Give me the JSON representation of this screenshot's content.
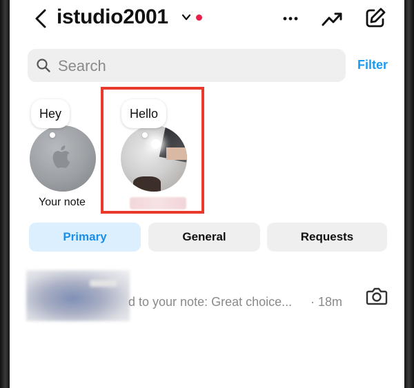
{
  "header": {
    "account_name": "istudio2001",
    "back_icon": "chevron-left-icon",
    "account_switch_icon": "chevron-down-icon",
    "unread_indicator_color": "#e8204a",
    "actions": [
      "more-icon",
      "trend-icon",
      "compose-icon"
    ]
  },
  "search": {
    "placeholder": "Search",
    "value": "",
    "filter_label": "Filter"
  },
  "notes": [
    {
      "bubble": "Hey",
      "label": "Your note"
    },
    {
      "bubble": "Hello",
      "label": ""
    }
  ],
  "tabs": [
    {
      "label": "Primary",
      "selected": true
    },
    {
      "label": "General",
      "selected": false
    },
    {
      "label": "Requests",
      "selected": false
    }
  ],
  "messages": [
    {
      "preview": "d to your note: Great choice...",
      "time": "· 18m",
      "action_icon": "camera-icon"
    }
  ],
  "colors": {
    "accent": "#1a9bf0",
    "selected_tab_bg": "#dcefff",
    "highlight": "#e8392a"
  }
}
